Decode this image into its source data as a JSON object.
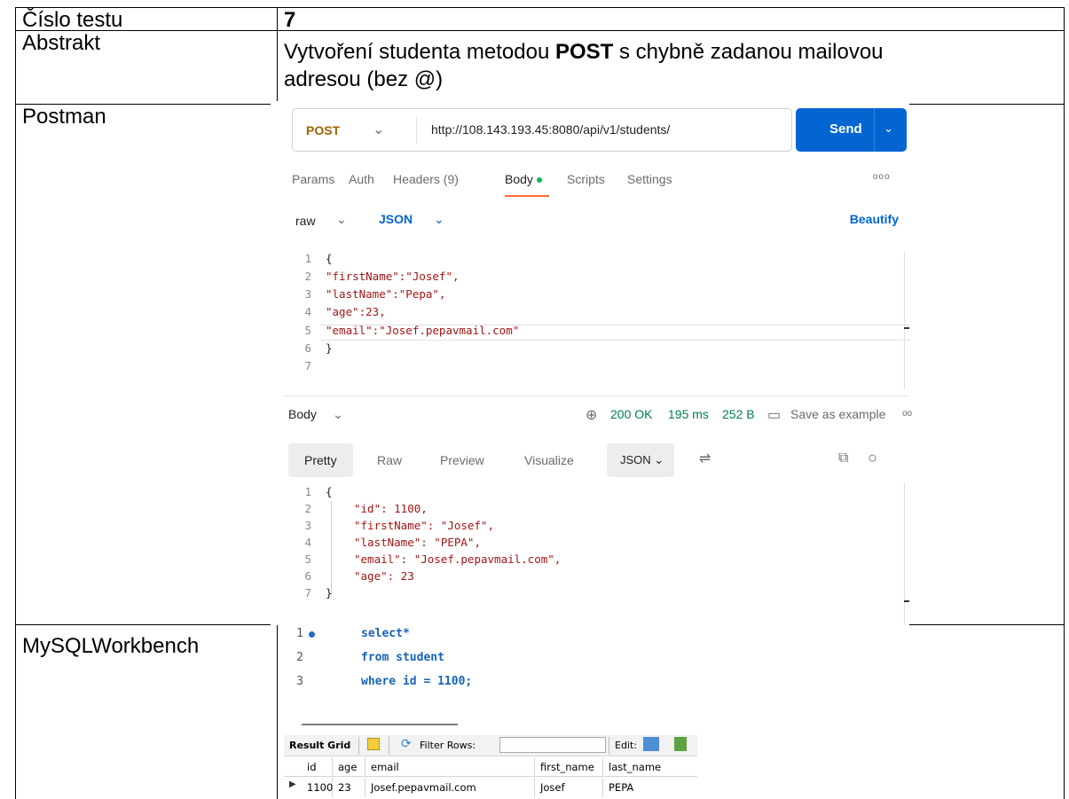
{
  "table": {
    "rows": [
      {
        "label": "Číslo testu",
        "value": "7"
      },
      {
        "label": "Abstrakt",
        "value_pre": "Vytvoření studenta metodou ",
        "value_bold": "POST",
        "value_post": " s chybně zadanou mailovou",
        "value_line2": "adresou (bez @)"
      },
      {
        "label": "Postman"
      },
      {
        "label": "MySQLWorkbench"
      }
    ]
  },
  "postman": {
    "method": "POST",
    "url": "http://108.143.193.45:8080/api/v1/students/",
    "send_label": "Send",
    "tabs": [
      "Params",
      "Auth",
      "Headers (9)",
      "Body",
      "Scripts",
      "Settings"
    ],
    "active_tab": "Body",
    "more": "ooo",
    "body_type": "raw",
    "body_format": "JSON",
    "beautify_label": "Beautify",
    "request_lines": [
      "{",
      "\"firstName\":\"Josef\",",
      "\"lastName\":\"Pepa\",",
      "\"age\":23,",
      "\"email\":\"Josef.pepavmail.com\"",
      "}",
      ""
    ],
    "response": {
      "label": "Body",
      "status": "200 OK",
      "time": "195 ms",
      "size": "252 B",
      "save_label": "Save as example",
      "more": "oo",
      "view_tabs": [
        "Pretty",
        "Raw",
        "Preview",
        "Visualize"
      ],
      "active_view": "Pretty",
      "format": "JSON",
      "lines": [
        "{",
        "\"id\": 1100,",
        "\"firstName\": \"Josef\",",
        "\"lastName\": \"PEPA\",",
        "\"email\": \"Josef.pepavmail.com\",",
        "\"age\": 23",
        "}"
      ]
    }
  },
  "workbench": {
    "query_lines": [
      "select*",
      "from student",
      "where id = 1100;"
    ],
    "toolbar": {
      "result_grid": "Result Grid",
      "filter_rows": "Filter Rows:",
      "edit": "Edit:"
    },
    "columns": [
      "id",
      "age",
      "email",
      "first_name",
      "last_name"
    ],
    "rows": [
      [
        "1100",
        "23",
        "Josef.pepavmail.com",
        "Josef",
        "PEPA"
      ]
    ]
  },
  "colors": {
    "postman_send": "#0265d2",
    "postman_method": "#a36200",
    "postman_tab_accent": "#ff6c37",
    "status_ok": "#00804a"
  }
}
